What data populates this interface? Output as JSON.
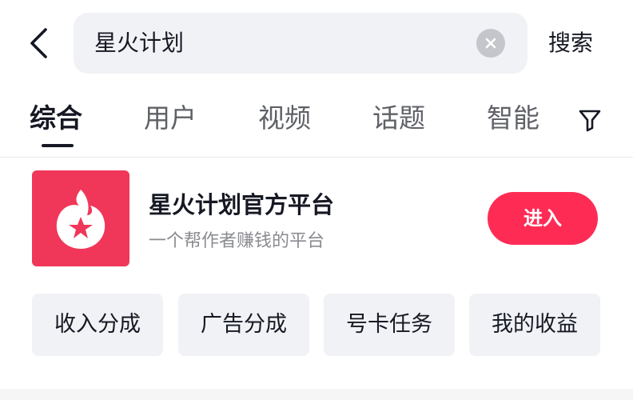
{
  "search": {
    "query": "星火计划",
    "submit_label": "搜索"
  },
  "tabs": [
    {
      "label": "综合",
      "active": true
    },
    {
      "label": "用户",
      "active": false
    },
    {
      "label": "视频",
      "active": false
    },
    {
      "label": "话题",
      "active": false
    },
    {
      "label": "智能",
      "active": false
    }
  ],
  "result": {
    "title": "星火计划官方平台",
    "subtitle": "一个帮作者赚钱的平台",
    "enter_label": "进入",
    "chips": [
      {
        "label": "收入分成"
      },
      {
        "label": "广告分成"
      },
      {
        "label": "号卡任务"
      },
      {
        "label": "我的收益"
      }
    ]
  },
  "colors": {
    "accent": "#fe2c55",
    "icon_bg": "#f0375a",
    "chip_bg": "#f1f2f5"
  },
  "icons": {
    "back": "chevron-left-icon",
    "clear": "close-icon",
    "filter": "filter-icon",
    "app_logo": "flame-star-logo"
  }
}
